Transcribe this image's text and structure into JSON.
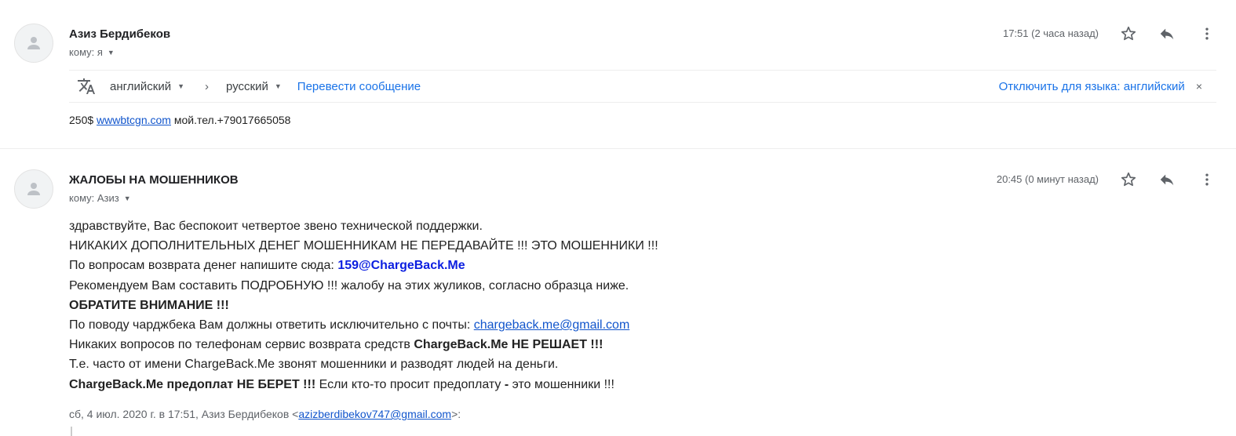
{
  "message1": {
    "sender": "Азиз Бердибеков",
    "to_label": "кому: я",
    "time": "17:51 (2 часа назад)",
    "translate_bar": {
      "from_lang": "английский",
      "arrow": "›",
      "to_lang": "русский",
      "translate_link": "Перевести сообщение",
      "disable_link": "Отключить для языка: английский",
      "close": "×"
    },
    "body": {
      "prefix": "250$",
      "link": "wwwbtcgn.com",
      "suffix": "мой.тел.+79017665058"
    }
  },
  "message2": {
    "sender": "ЖАЛОБЫ НА МОШЕННИКОВ",
    "to_label": "кому: Азиз",
    "time": "20:45 (0 минут назад)",
    "body": {
      "line1": "здравствуйте, Вас беспокоит четвертое звено технической поддержки.",
      "line2": "НИКАКИХ ДОПОЛНИТЕЛЬНЫХ ДЕНЕГ МОШЕННИКАМ НЕ ПЕРЕДАВАЙТЕ !!! ЭТО МОШЕННИКИ !!!",
      "line3_text": "По вопросам возврата денег напишите сюда: ",
      "line3_email": "159@ChargeBack.Me",
      "line4": "Рекомендуем Вам составить ПОДРОБНУЮ !!! жалобу на этих жуликов, согласно образца ниже.",
      "line5": "ОБРАТИТЕ ВНИМАНИЕ !!!",
      "line6_text": "По поводу чарджбека Вам должны ответить исключительно с почты: ",
      "line6_link": "chargeback.me@gmail.com",
      "line7_text": "Никаких вопросов по телефонам сервис возврата средств ",
      "line7_bold": "ChargeBack.Me НЕ РЕШАЕТ !!!",
      "line8": "Т.е. часто от имени ChargeBack.Me звонят мошенники и разводят людей на деньги.",
      "line9_bold": "ChargeBack.Me предоплат НЕ БЕРЕТ !!!",
      "line9_text": " Если кто-то просит предоплату ",
      "line9_dash": "-",
      "line9_text2": " это мошенники !!!"
    },
    "quote": {
      "prefix": "сб, 4 июл. 2020 г. в 17:51, Азиз Бердибеков <",
      "email": "azizberdibekov747@gmail.com",
      "suffix": ">:"
    }
  },
  "icons": [
    "avatar-person-icon",
    "star-icon",
    "reply-icon",
    "more-vert-icon",
    "translate-icon",
    "dropdown-caret-icon"
  ],
  "colors": {
    "link": "#1155cc",
    "accent_link": "#1a73e8",
    "email_blue": "#0b1ee0",
    "muted": "#5f6368",
    "avatar_bg": "#f1f3f4"
  }
}
